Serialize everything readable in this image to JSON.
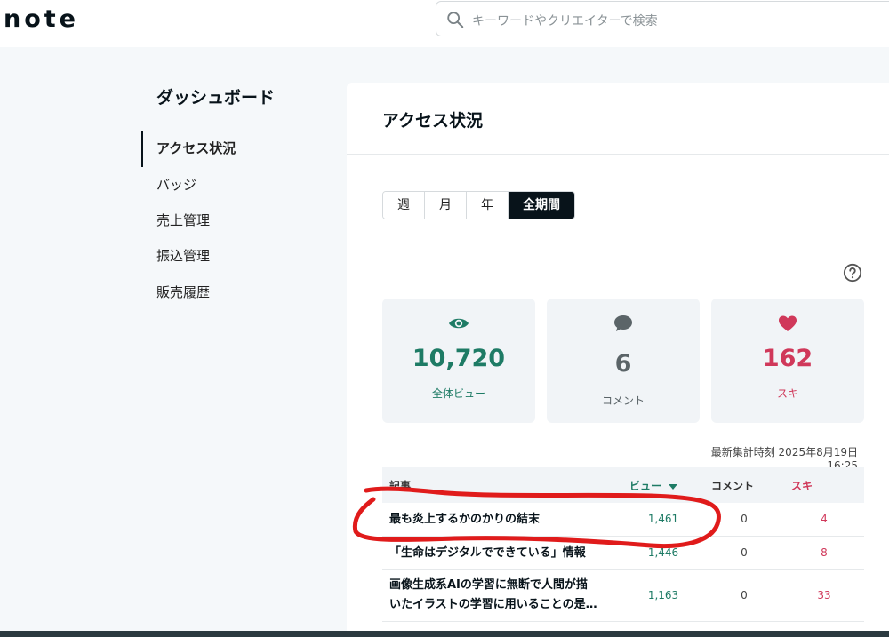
{
  "header": {
    "logo": "note",
    "search_placeholder": "キーワードやクリエイターで検索"
  },
  "sidebar": {
    "title": "ダッシュボード",
    "items": [
      {
        "label": "アクセス状況",
        "active": true
      },
      {
        "label": "バッジ"
      },
      {
        "label": "売上管理"
      },
      {
        "label": "振込管理"
      },
      {
        "label": "販売履歴"
      }
    ]
  },
  "main": {
    "title": "アクセス状況",
    "tabs": [
      {
        "label": "週"
      },
      {
        "label": "月"
      },
      {
        "label": "年"
      },
      {
        "label": "全期間",
        "active": true
      }
    ],
    "stats": {
      "views": {
        "value": "10,720",
        "label": "全体ビュー"
      },
      "comments": {
        "value": "6",
        "label": "コメント"
      },
      "likes": {
        "value": "162",
        "label": "スキ"
      }
    },
    "updated": "最新集計時刻 2025年8月19日 16:25",
    "table": {
      "headers": {
        "article": "記事",
        "views": "ビュー",
        "comments": "コメント",
        "likes": "スキ"
      },
      "rows": [
        {
          "title": "最も炎上するかのかりの結末",
          "views": "1,461",
          "comments": "0",
          "likes": "4"
        },
        {
          "title": "「生命はデジタルでできている」情報",
          "views": "1,446",
          "comments": "0",
          "likes": "8"
        },
        {
          "title_line1": "画像生成系AIの学習に無断で人間が描",
          "title_line2": "いたイラストの学習に用いることの是…",
          "views": "1,163",
          "comments": "0",
          "likes": "33"
        }
      ]
    }
  },
  "colors": {
    "view_green": "#1e7b65",
    "like_red": "#d0385a",
    "comment_gray": "#5b6468",
    "annotation_red": "#e01b1b"
  }
}
